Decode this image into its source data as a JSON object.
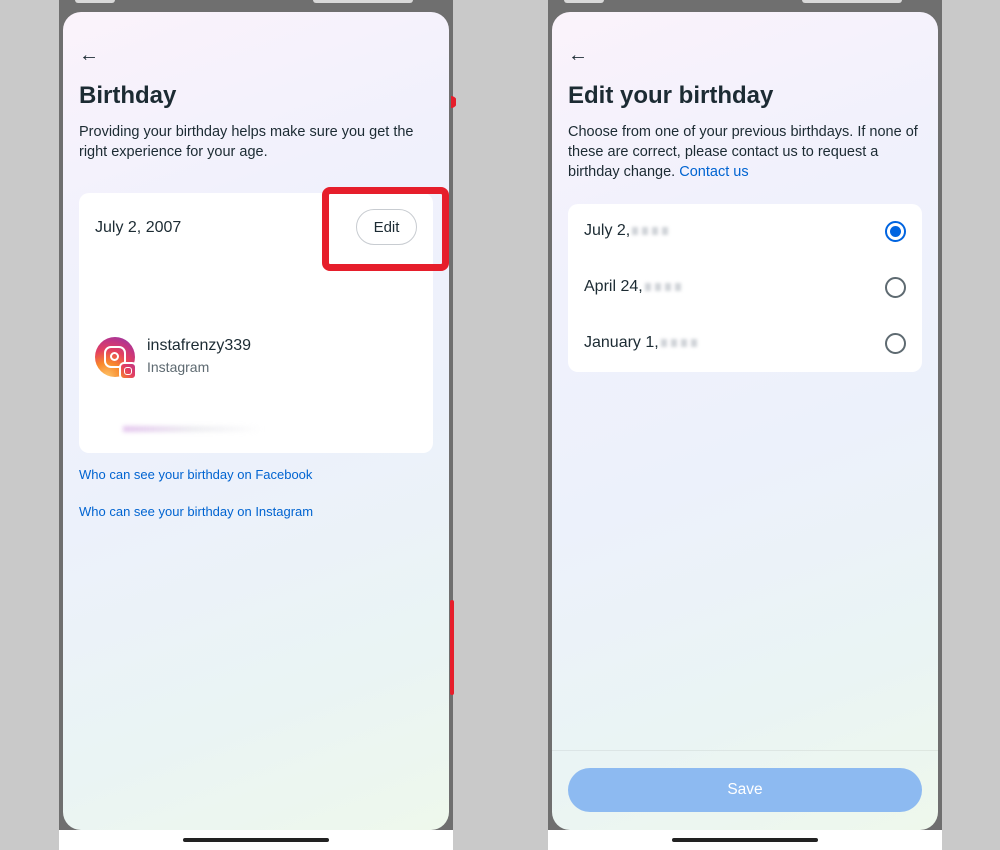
{
  "left": {
    "title": "Birthday",
    "description": "Providing your birthday helps make sure you get the right experience for your age.",
    "birthday": "July 2, 2007",
    "edit_label": "Edit",
    "account": {
      "username": "instafrenzy339",
      "app": "Instagram"
    },
    "links": [
      "Who can see your birthday on Facebook",
      "Who can see your birthday on Instagram"
    ]
  },
  "right": {
    "title": "Edit your birthday",
    "description": "Choose from one of your previous birthdays. If none of these are correct, please contact us to request a birthday change.",
    "contact_link": "Contact us",
    "options": [
      {
        "label": "July 2,",
        "selected": true
      },
      {
        "label": "April 24,",
        "selected": false
      },
      {
        "label": "January 1,",
        "selected": false
      }
    ],
    "save_label": "Save"
  },
  "colors": {
    "link": "#0064d1",
    "primary": "#0064e0",
    "highlight": "#e61e2b",
    "save_disabled": "#8dbaf1"
  }
}
